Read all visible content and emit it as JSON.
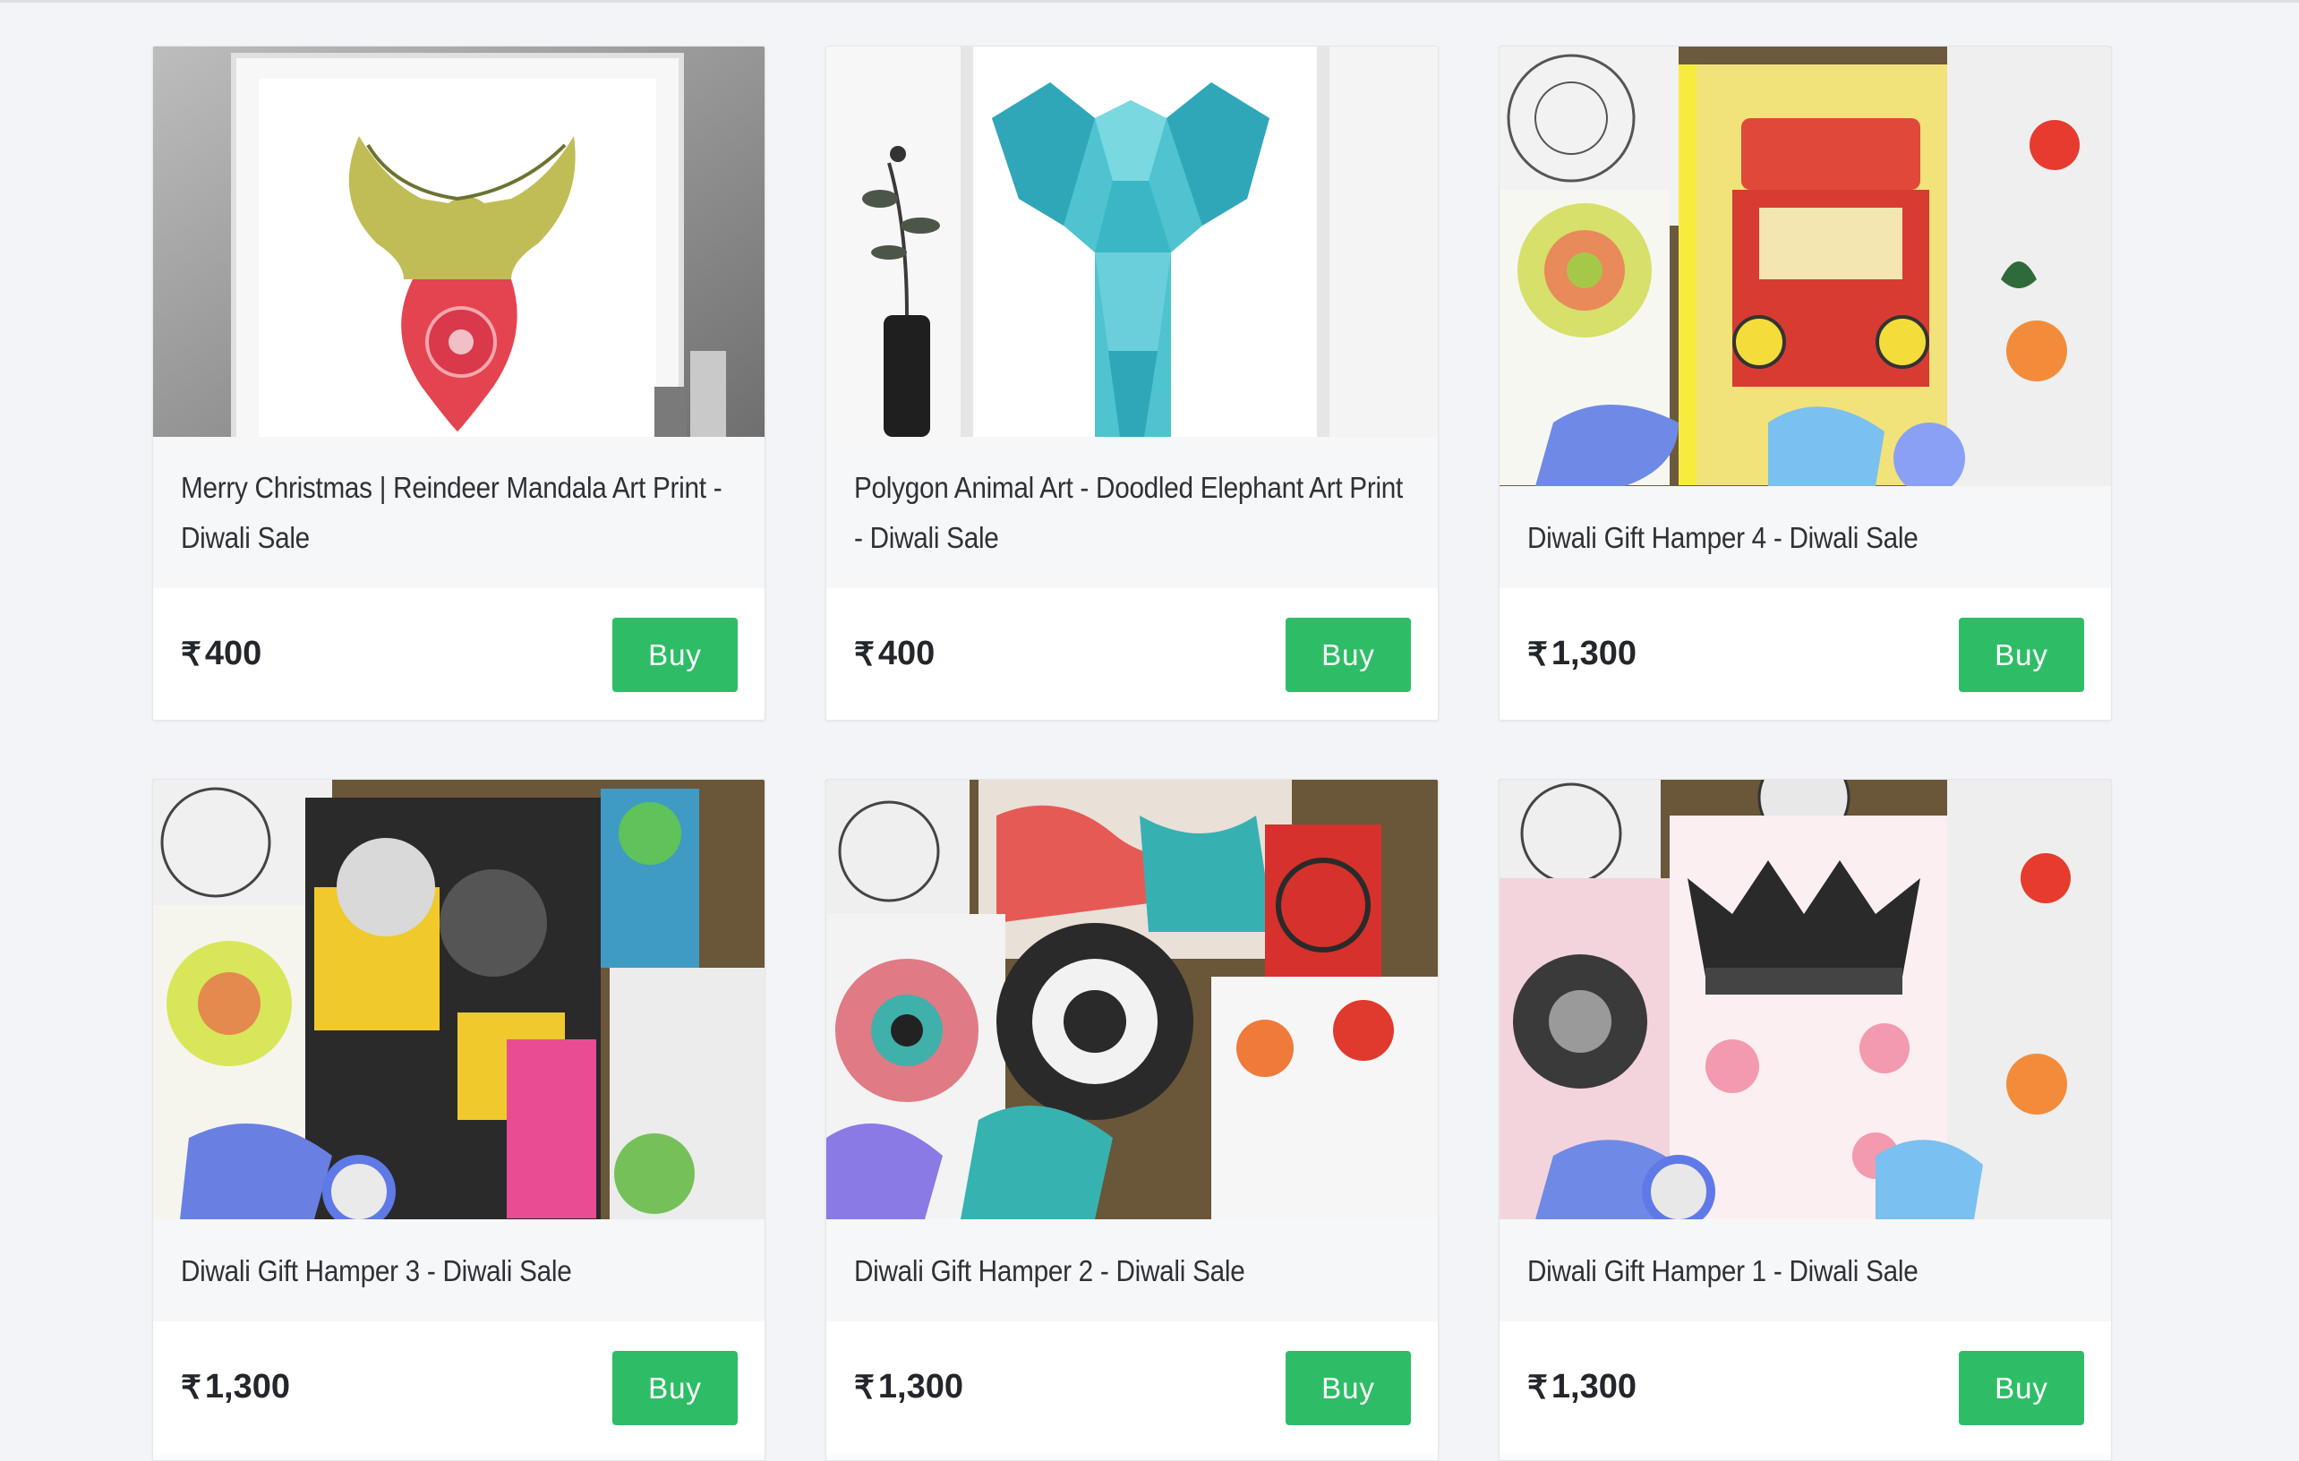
{
  "currency_symbol": "₹",
  "button_label": "Buy",
  "colors": {
    "page_bg": "#f3f4f7",
    "buy_button": "#2ebd66",
    "title_text": "#2e3135",
    "price_text": "#23262a"
  },
  "products": [
    {
      "title": "Merry Christmas | Reindeer Mandala Art Print - Diwali Sale",
      "price": "400",
      "image_icon": "reindeer-mandala-print-image"
    },
    {
      "title": "Polygon Animal Art - Doodled Elephant Art Print - Diwali Sale",
      "price": "400",
      "image_icon": "polygon-elephant-print-image"
    },
    {
      "title": "Diwali Gift Hamper 4 - Diwali Sale",
      "price": "1,300",
      "image_icon": "gift-hamper-truck-image"
    },
    {
      "title": "Diwali Gift Hamper 3 - Diwali Sale",
      "price": "1,300",
      "image_icon": "gift-hamper-floral-image"
    },
    {
      "title": "Diwali Gift Hamper 2 - Diwali Sale",
      "price": "1,300",
      "image_icon": "gift-hamper-paisley-image"
    },
    {
      "title": "Diwali Gift Hamper 1 - Diwali Sale",
      "price": "1,300",
      "image_icon": "gift-hamper-crown-image"
    }
  ]
}
